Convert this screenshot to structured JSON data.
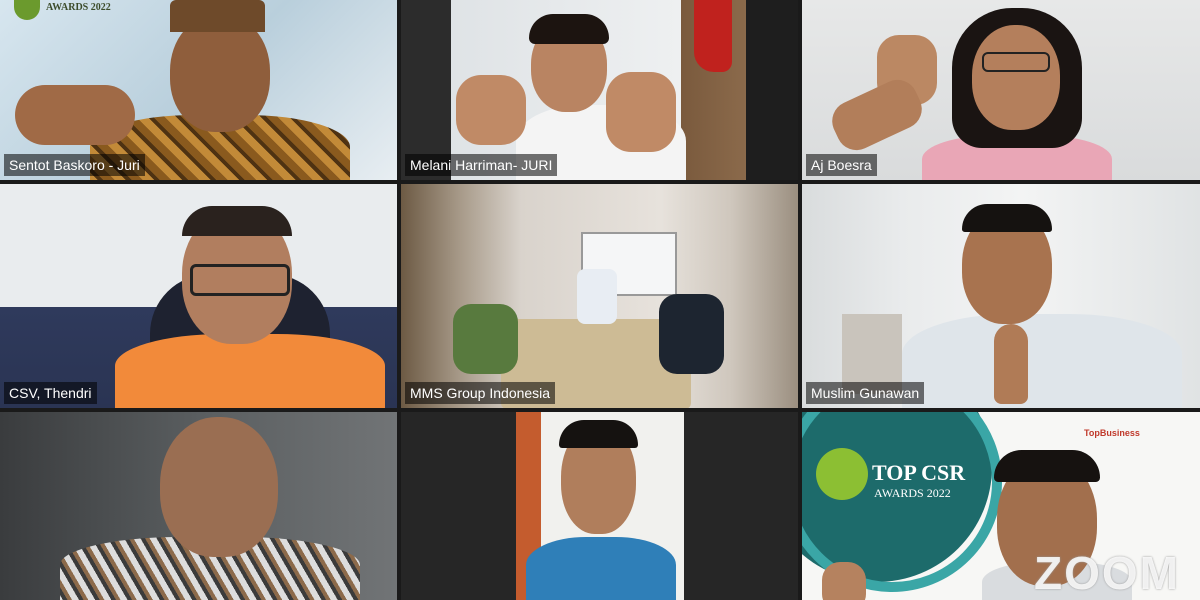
{
  "meeting": {
    "app": "zoom",
    "participants": [
      {
        "name": "Sentot Baskoro - Juri"
      },
      {
        "name": "Melani Harriman- JURI"
      },
      {
        "name": "Aj Boesra"
      },
      {
        "name": "CSV, Thendri"
      },
      {
        "name": "MMS Group Indonesia"
      },
      {
        "name": "Muslim Gunawan"
      },
      {
        "name": ""
      },
      {
        "name": ""
      },
      {
        "name": ""
      }
    ],
    "active_speaker_index": 8,
    "active_color": "#35c135"
  },
  "award": {
    "title": "TOP CSR",
    "subtitle": "AWARDS 2022",
    "brand": "TopBusiness",
    "top_logo_text": "AWARDS 2022"
  },
  "watermark": "ZOOM"
}
